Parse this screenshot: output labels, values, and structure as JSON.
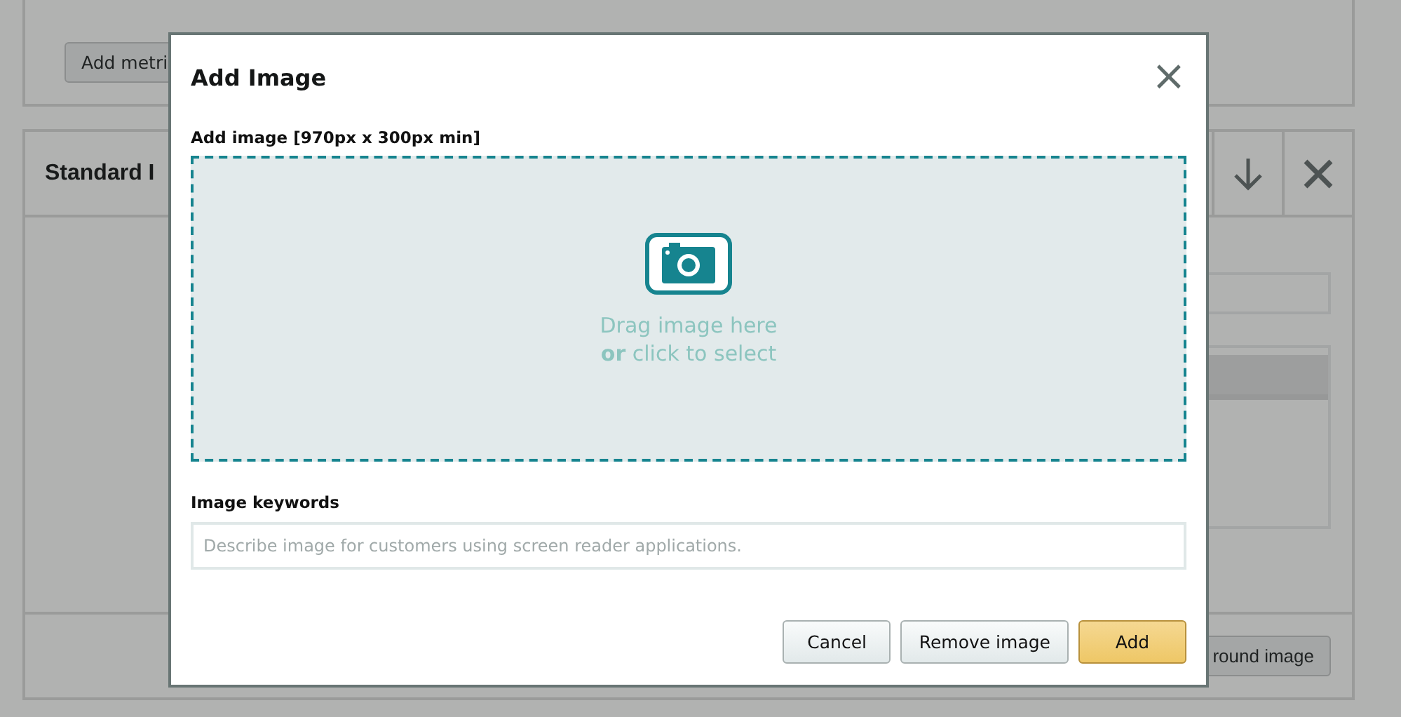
{
  "background": {
    "metrics_button": "Add metri",
    "module_title": "Standard I",
    "background_button": "round image"
  },
  "dialog": {
    "title": "Add Image",
    "close": "×",
    "upload_label": "Add image [970px x 300px min]",
    "drop_lines": [
      "Drag image here",
      "**or** click to select"
    ],
    "keywords_label": "Image keywords",
    "keywords_placeholder": "Describe image for customers using screen reader applications.",
    "buttons": [
      {
        "label": "Cancel",
        "kind": "secondary"
      },
      {
        "label": "Remove image",
        "kind": "secondary"
      },
      {
        "label": "Add",
        "kind": "primary"
      }
    ]
  }
}
